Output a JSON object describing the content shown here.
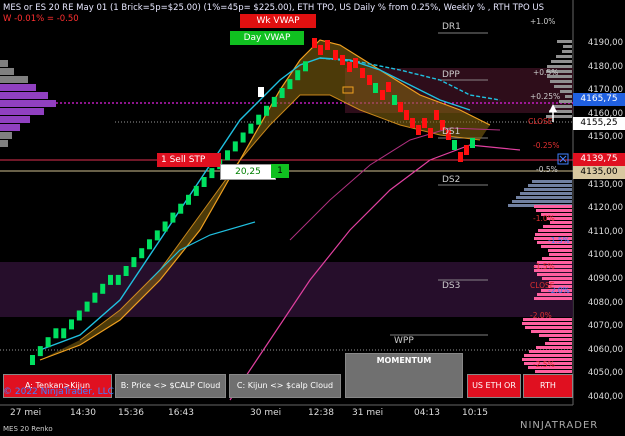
{
  "header": {
    "title": "MES or ES 20 RE May 01 (1 Brick=5p=$25.00) (1%=45p= $225.00), ETH TPO, US Daily % from 0.25%, Weekly % , RTH TPO US",
    "weekly_change": "W -0.01% = -0.50"
  },
  "tags": {
    "wk_vwap": "Wk VWAP",
    "day_vwap": "Day VWAP",
    "sell_stp": "1  Sell STP",
    "value": "20,25",
    "qty": "1"
  },
  "levels": {
    "dr1": "DR1",
    "dpp": "DPP",
    "ds1": "DS1",
    "ds2": "DS2",
    "ds3": "DS3",
    "wpp": "WPP"
  },
  "percent_labels": {
    "p1": "+1.0%",
    "p05": "+0.5%",
    "p025": "+0.25%",
    "close": "CLOSE",
    "m025": "-0.25%",
    "m05": "-0.5%",
    "m1": "-1.0%",
    "m15": "-1.5%",
    "m15b": "-1.5%",
    "m2": "-2.0%",
    "m2b": "-2.0%",
    "close2": "CLOSE",
    "m25": "-2.5%"
  },
  "price_axis": [
    "4190,00",
    "4180,00",
    "4170,00",
    "4160,00",
    "4150,00",
    "4140,00",
    "4130,00",
    "4120,00",
    "4110,00",
    "4100,00",
    "4090,00",
    "4080,00",
    "4070,00",
    "4060,00",
    "4050,00",
    "4040,00"
  ],
  "price_boxes": {
    "p1": "4165,75",
    "p2": "4155,25",
    "p3": "4139,75",
    "p4": "4135,00"
  },
  "time_axis": [
    "27 mei",
    "14:30",
    "15:36",
    "16:43",
    "30 mei",
    "12:38",
    "31 mei",
    "04:13",
    "10:15"
  ],
  "buttons": {
    "a": "A: Tenkan>Kijun",
    "b": "B: Price <> $CALP Cloud",
    "c": "C: Kijun <> $calp Cloud",
    "momentum": "MOMENTUM",
    "us_eth": "US ETH OR",
    "rth": "RTH"
  },
  "footer": {
    "copyright": "© 2022 NinjaTrader, LLC",
    "instrument": "MES 20 Renko",
    "brand": "NINJATRADER"
  },
  "colors": {
    "up": "#00e060",
    "down": "#ff1010",
    "cyan": "#20c0e0",
    "magenta": "#e020e0",
    "orange": "#f0a020",
    "pink": "#ff60a0"
  }
}
